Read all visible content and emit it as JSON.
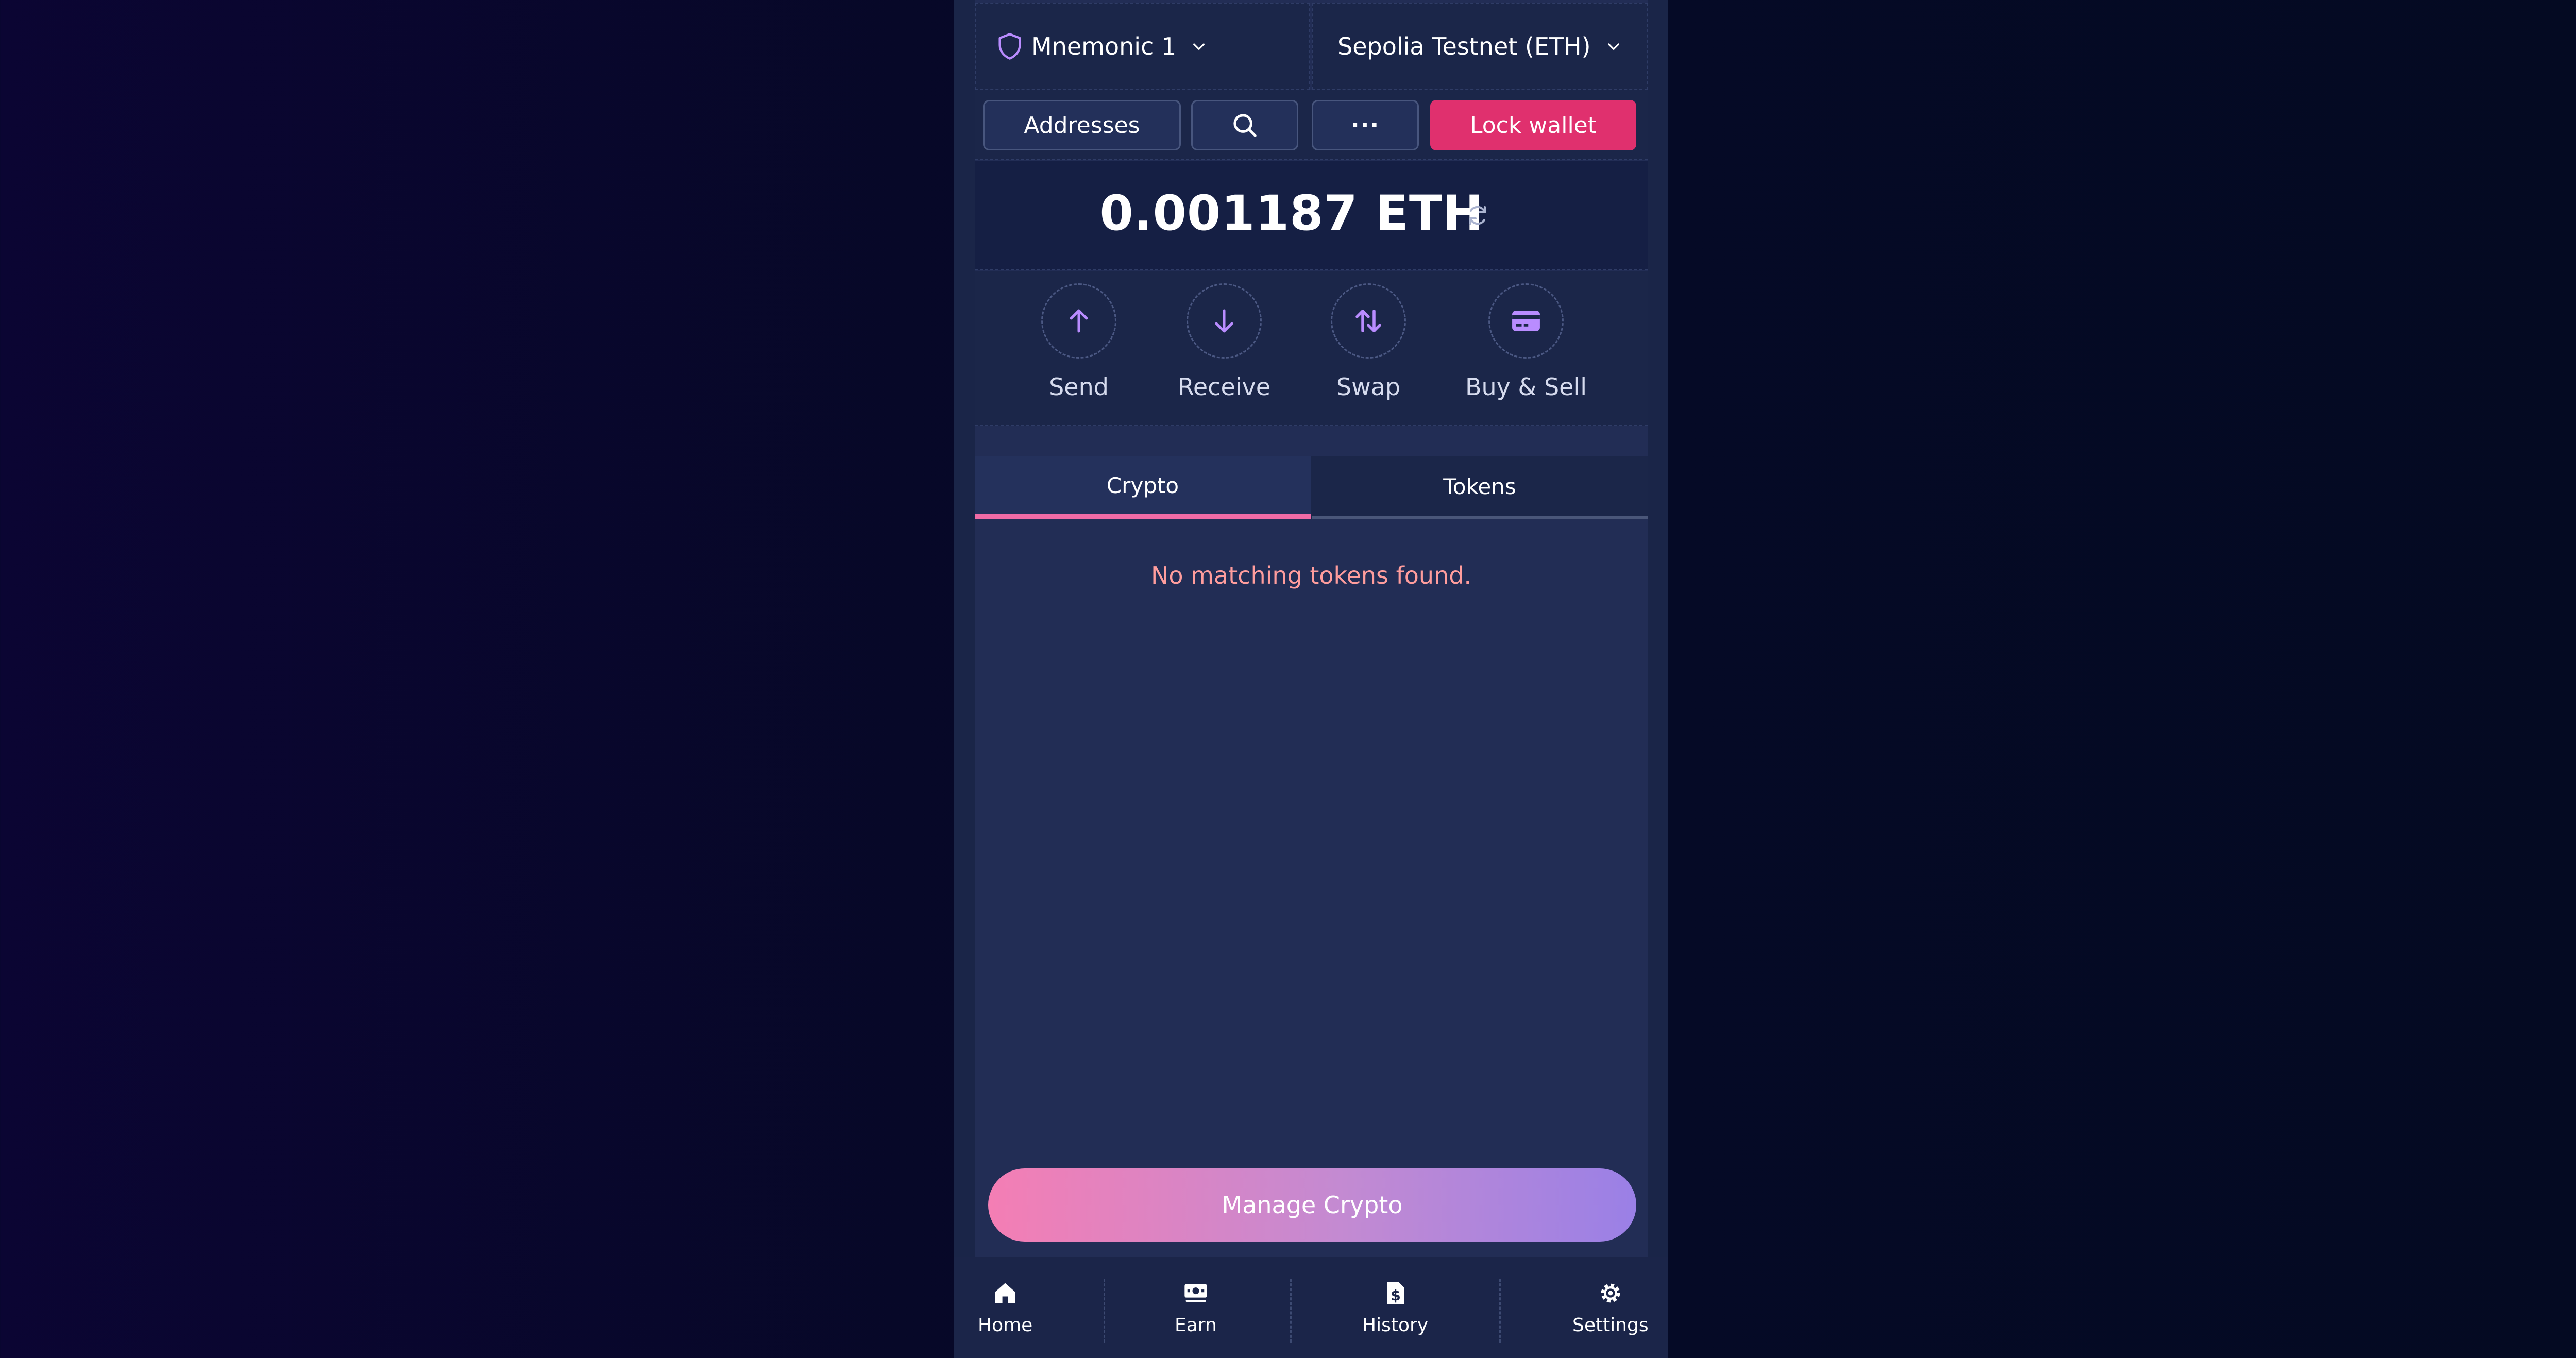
{
  "header": {
    "account_label": "Mnemonic 1",
    "network_label": "Sepolia Testnet (ETH)"
  },
  "toolbar": {
    "addresses_label": "Addresses",
    "more_label": "···",
    "lock_label": "Lock wallet"
  },
  "balance": {
    "value": "0.001187 ETH"
  },
  "actions": [
    {
      "label": "Send",
      "icon": "arrow-up-icon"
    },
    {
      "label": "Receive",
      "icon": "arrow-down-icon"
    },
    {
      "label": "Swap",
      "icon": "swap-icon"
    },
    {
      "label": "Buy & Sell",
      "icon": "card-icon"
    }
  ],
  "tabs": [
    {
      "label": "Crypto",
      "active": true
    },
    {
      "label": "Tokens",
      "active": false
    }
  ],
  "empty_message": "No matching tokens found.",
  "manage_button_label": "Manage Crypto",
  "nav": [
    {
      "label": "Home",
      "icon": "home-icon"
    },
    {
      "label": "Earn",
      "icon": "earn-icon"
    },
    {
      "label": "History",
      "icon": "history-icon"
    },
    {
      "label": "Settings",
      "icon": "settings-icon"
    }
  ],
  "colors": {
    "accent_pink": "#e0306e",
    "icon_purple": "#b98cff",
    "error_text": "#ff9d9d"
  }
}
